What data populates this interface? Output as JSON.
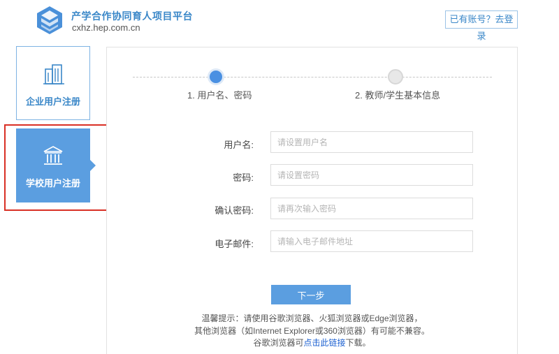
{
  "header": {
    "title": "产学合作协同育人项目平台",
    "url": "cxhz.hep.com.cn",
    "login_link": "已有账号？去登录"
  },
  "tabs": {
    "enterprise_label": "企业用户注册",
    "school_label": "学校用户注册",
    "active": "school"
  },
  "steps": {
    "step1": "1. 用户名、密码",
    "step2": "2. 教师/学生基本信息",
    "current": 1
  },
  "form": {
    "username_label": "用户名:",
    "username_placeholder": "请设置用户名",
    "password_label": "密码:",
    "password_placeholder": "请设置密码",
    "confirm_label": "确认密码:",
    "confirm_placeholder": "请再次输入密码",
    "email_label": "电子邮件:",
    "email_placeholder": "请输入电子邮件地址",
    "next_button": "下一步"
  },
  "tip": {
    "line1": "温馨提示：请使用谷歌浏览器、火狐浏览器或Edge浏览器，",
    "line2": "其他浏览器（如Internet Explorer或360浏览器）有可能不兼容。",
    "line3_prefix": "谷歌浏览器可",
    "line3_link": "点击此链接",
    "line3_suffix": "下载。"
  },
  "colors": {
    "accent": "#5b9ee0",
    "brand_text": "#3a87c8",
    "highlight": "#d93025",
    "link": "#1a5fd0"
  }
}
